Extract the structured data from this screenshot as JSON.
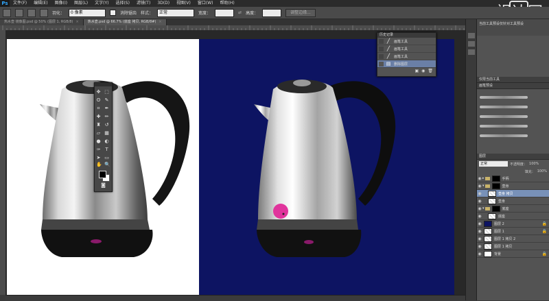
{
  "app": {
    "logo": "Ps",
    "watermark": "视达网"
  },
  "menu": [
    "文件(F)",
    "编辑(E)",
    "图像(I)",
    "图层(L)",
    "文字(Y)",
    "选择(S)",
    "滤镜(T)",
    "3D(D)",
    "视图(V)",
    "窗口(W)",
    "帮助(H)"
  ],
  "options": {
    "feather_label": "羽化：",
    "feather_value": "0 像素",
    "antialias_label": "消除锯齿",
    "style_label": "样式：",
    "style_value": "正常",
    "width_label": "宽度：",
    "height_label": "高度：",
    "refine_button": "调整边缘..."
  },
  "tabs": [
    {
      "label": "热水壶 镜像图.psd @ 50% (图层 1, RGB/8)",
      "active": false
    },
    {
      "label": "热水壶.psd @ 66.7% (底座 拷贝, RGB/8#)",
      "active": true
    }
  ],
  "history": {
    "title": "历史记录",
    "items": [
      {
        "label": "画笔工具",
        "selected": false
      },
      {
        "label": "画笔工具",
        "selected": false
      },
      {
        "label": "画笔工具",
        "selected": false
      },
      {
        "label": "删除图层",
        "selected": true
      }
    ]
  },
  "right_panel": {
    "tooltip": "当前工具预设仅针对工具预设",
    "brush_title": "画笔预设",
    "tool_preset_title": "仅限当前工具",
    "layers_title": "图层",
    "blend_mode": "正常",
    "opacity_label": "不透明度：",
    "opacity_value": "100%",
    "fill_label": "填充：",
    "fill_value": "100%",
    "layers": [
      {
        "name": "手柄",
        "type": "group",
        "selected": false
      },
      {
        "name": "壶身",
        "type": "group",
        "selected": false
      },
      {
        "name": "壶身 拷贝",
        "type": "layer",
        "selected": true
      },
      {
        "name": "壶身",
        "type": "layer",
        "selected": false
      },
      {
        "name": "底座",
        "type": "group",
        "selected": false
      },
      {
        "name": "底座",
        "type": "layer",
        "selected": false
      },
      {
        "name": "图层 2",
        "type": "layer",
        "selected": false
      },
      {
        "name": "图层 1",
        "type": "layer",
        "selected": false
      },
      {
        "name": "图层 1 拷贝 2",
        "type": "layer",
        "selected": false
      },
      {
        "name": "图层 1 拷贝",
        "type": "layer",
        "selected": false
      },
      {
        "name": "背景",
        "type": "layer",
        "selected": false
      }
    ]
  },
  "colors": {
    "canvas_blue": "#0d1462",
    "highlight": "#7891b8",
    "brush_dot": "#e0349c"
  }
}
